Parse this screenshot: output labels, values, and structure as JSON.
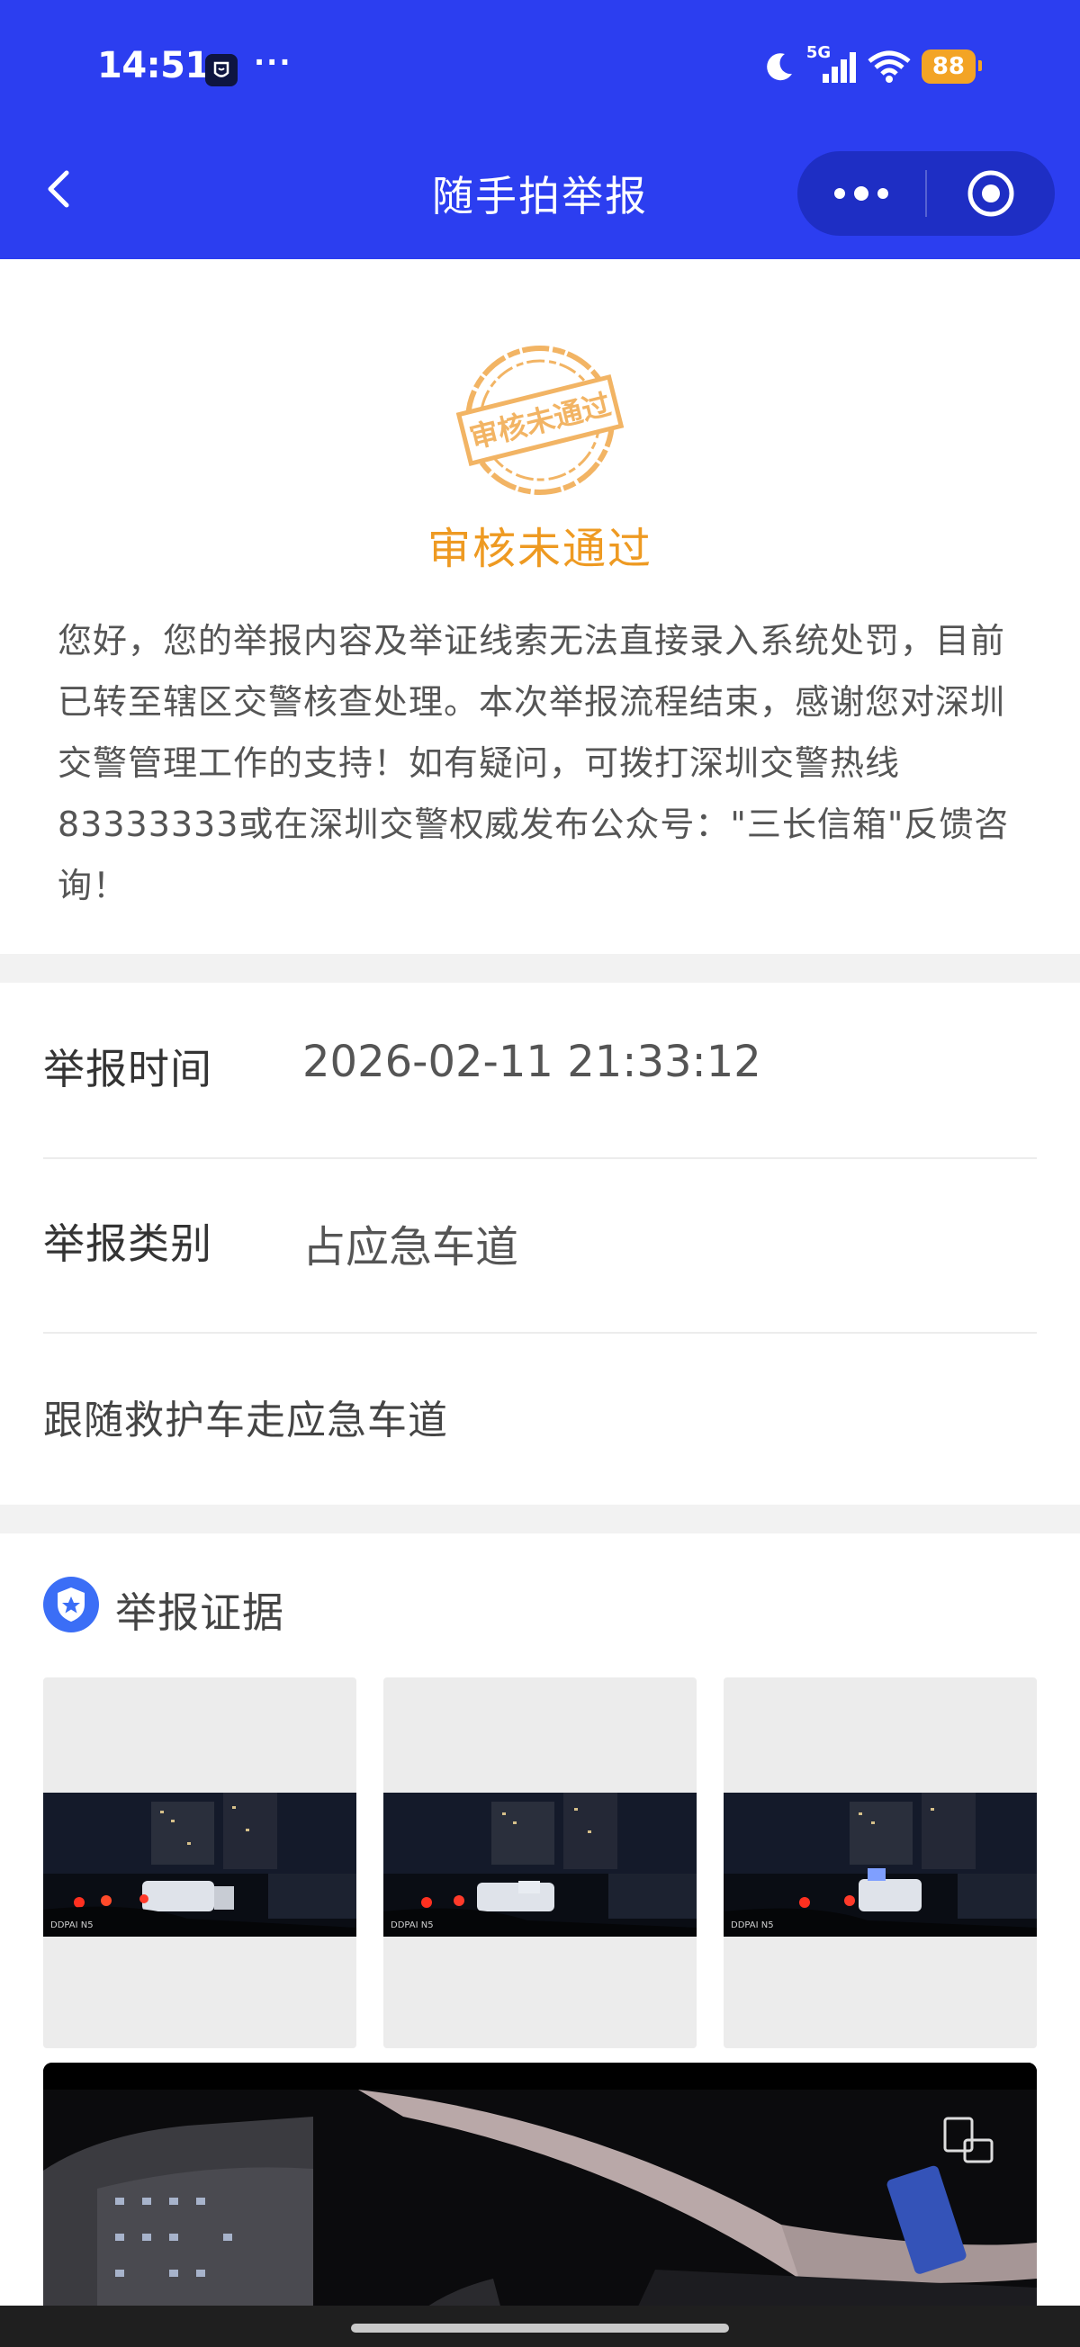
{
  "status_bar": {
    "time": "14:51",
    "dots": "···",
    "network": "5G",
    "battery": "88"
  },
  "nav": {
    "title": "随手拍举报",
    "back_icon": "chevron-left-icon",
    "menu_icon": "more-dots-icon",
    "close_icon": "target-circle-icon"
  },
  "review": {
    "stamp_text": "审核未通过",
    "status_title": "审核未通过",
    "description": "您好，您的举报内容及举证线索无法直接录入系统处罚，目前已转至辖区交警核查处理。本次举报流程结束，感谢您对深圳交警管理工作的支持！如有疑问，可拨打深圳交警热线83333333或在深圳交警权威发布公众号：\"三长信箱\"反馈咨询！",
    "colors": {
      "accent": "#ee9a22"
    }
  },
  "details": {
    "rows": [
      {
        "label": "举报时间",
        "value": "2026-02-11 21:33:12"
      },
      {
        "label": "举报类别",
        "value": "占应急车道"
      }
    ],
    "remark": "跟随救护车走应急车道"
  },
  "evidence": {
    "title": "举报证据",
    "icon": "badge-shield-icon",
    "photos": [
      {
        "caption": "DDPAI N5"
      },
      {
        "caption": "DDPAI N5"
      },
      {
        "caption": "DDPAI N5"
      }
    ],
    "video_icon": "rotate-screen-icon"
  },
  "colors": {
    "header_bg": "#2c3ef0",
    "capsule_bg": "#1e2ec4",
    "battery": "#f3a425"
  }
}
